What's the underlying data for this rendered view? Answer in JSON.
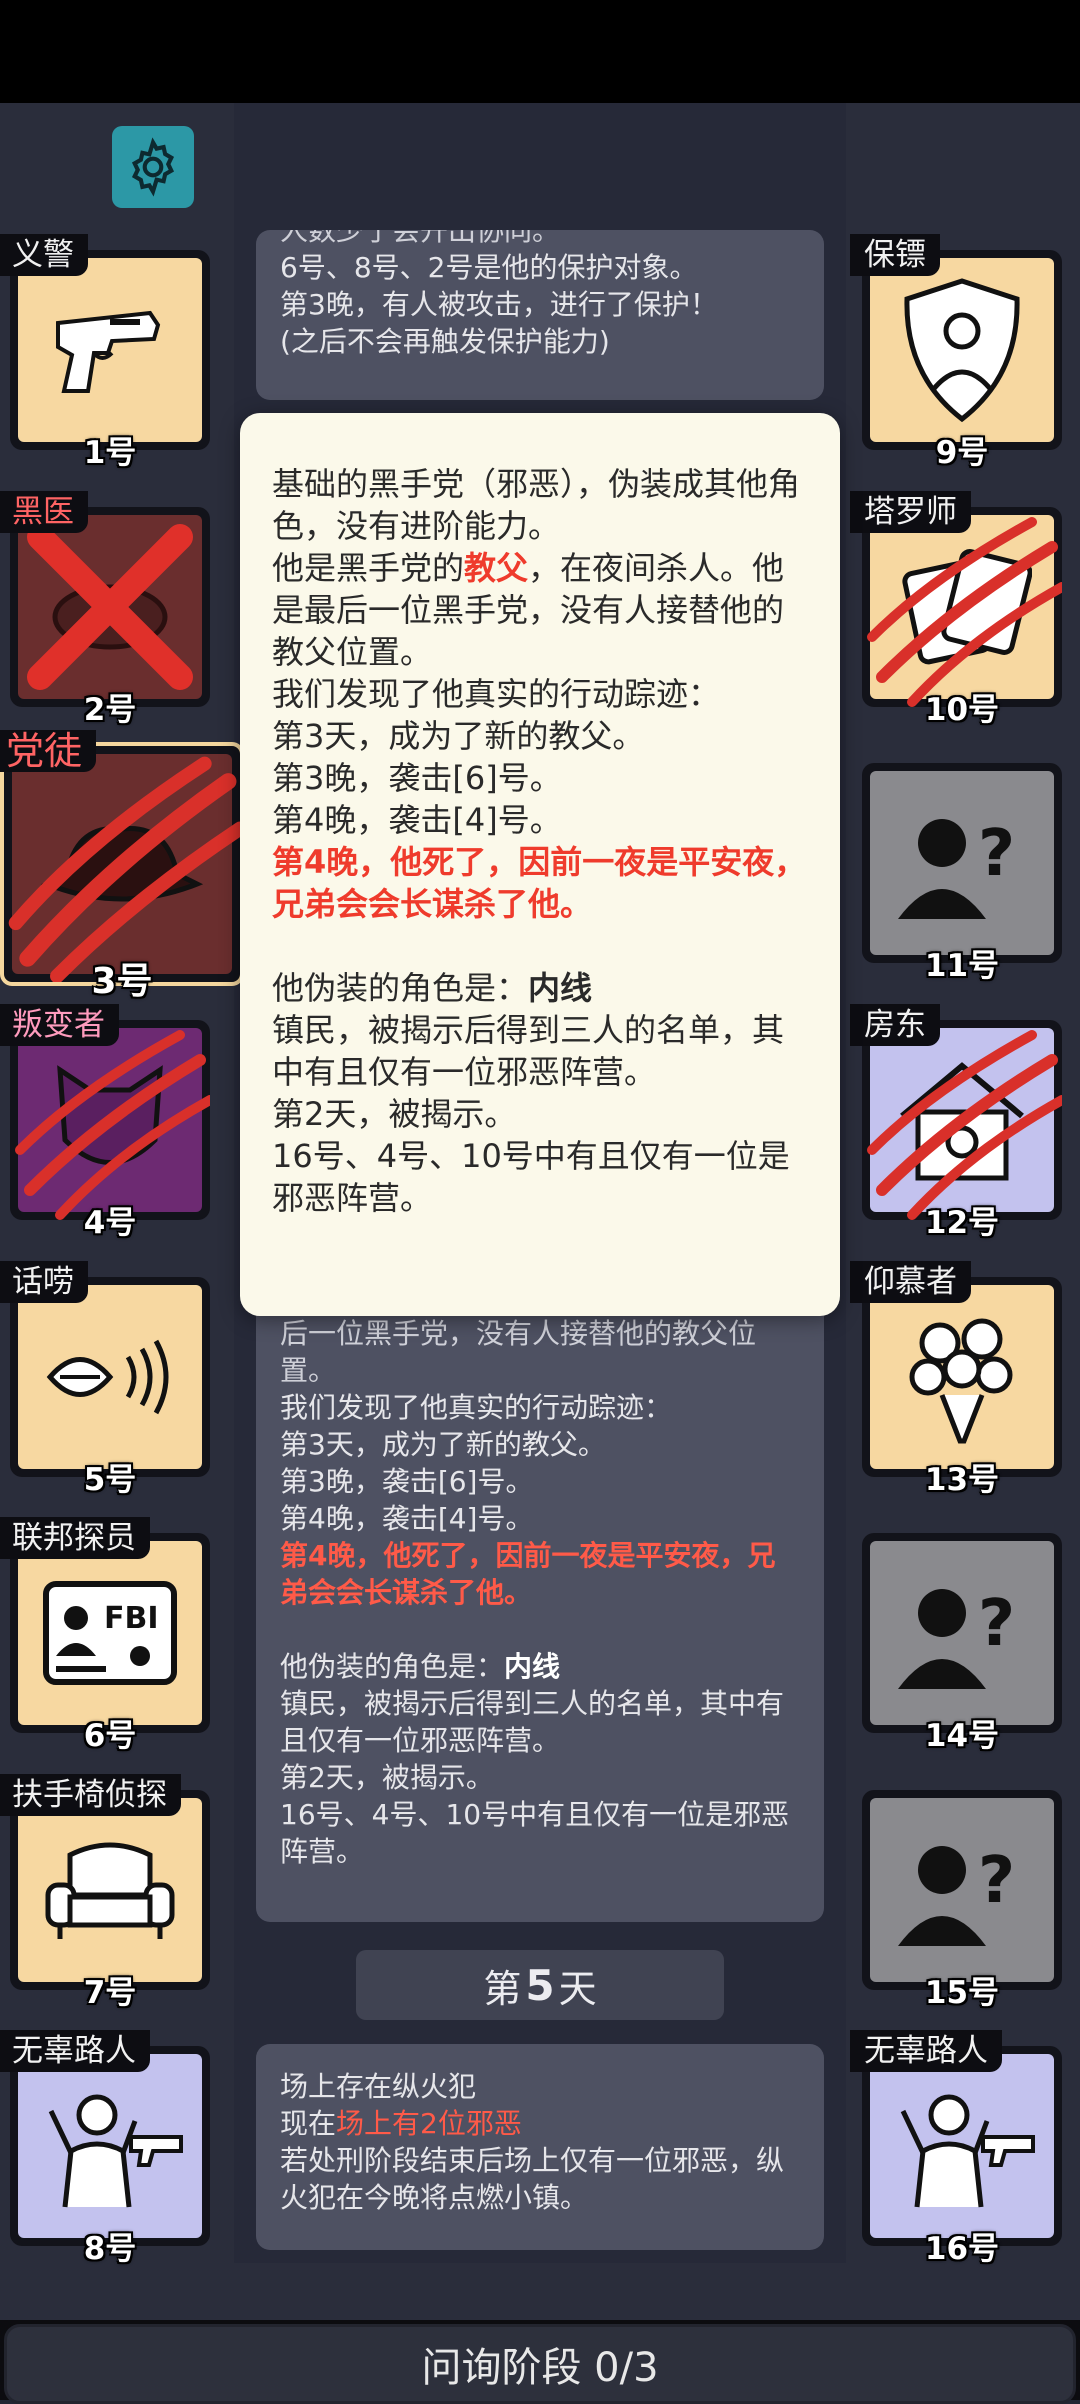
{
  "players": [
    {
      "role": "义警",
      "number": "1号",
      "icon": "pistol-icon"
    },
    {
      "role": "黑医",
      "number": "2号",
      "icon": "crossed-out-icon"
    },
    {
      "role": "党徒",
      "number": "3号",
      "icon": "fedora-hat-icon"
    },
    {
      "role": "叛变者",
      "number": "4号",
      "icon": "mask-icon"
    },
    {
      "role": "话唠",
      "number": "5号",
      "icon": "talking-mouth-icon"
    },
    {
      "role": "联邦探员",
      "number": "6号",
      "icon": "fbi-badge-icon"
    },
    {
      "role": "扶手椅侦探",
      "number": "7号",
      "icon": "armchair-icon"
    },
    {
      "role": "无辜路人",
      "number": "8号",
      "icon": "bystander-gun-icon"
    },
    {
      "role": "保镖",
      "number": "9号",
      "icon": "bodyguard-shield-icon"
    },
    {
      "role": "塔罗师",
      "number": "10号",
      "icon": "tarot-card-icon"
    },
    {
      "role": "",
      "number": "11号",
      "icon": "unknown-person-icon"
    },
    {
      "role": "房东",
      "number": "12号",
      "icon": "house-icon"
    },
    {
      "role": "仰慕者",
      "number": "13号",
      "icon": "bouquet-icon"
    },
    {
      "role": "",
      "number": "14号",
      "icon": "unknown-person-icon"
    },
    {
      "role": "",
      "number": "15号",
      "icon": "unknown-person-icon"
    },
    {
      "role": "无辜路人",
      "number": "16号",
      "icon": "bystander-gun-icon"
    }
  ],
  "log_top": {
    "line0": "人数少于会开出协同。",
    "line1": "6号、8号、2号是他的保护对象。",
    "line2": "第3晚，有人被攻击，进行了保护！",
    "line3": "(之后不会再触发保护能力)"
  },
  "popup": {
    "p1": "基础的黑手党（邪恶），伪装成其他角色，没有进阶能力。",
    "p2_pre": "他是黑手党的",
    "p2_role": "教父",
    "p2_post": "，在夜间杀人。他是最后一位黑手党，没有人接替他的教父位置。",
    "l1": "我们发现了他真实的行动踪迹：",
    "l2": "第3天，成为了新的教父。",
    "l3": "第3晚，袭击[6]号。",
    "l4": "第4晚，袭击[4]号。",
    "death": "第4晚，他死了，因前一夜是平安夜，兄弟会会长谋杀了他。",
    "disguise_label": "他伪装的角色是：",
    "disguise_role": "内线",
    "d1": "镇民，被揭示后得到三人的名单，其中有且仅有一位邪恶阵营。",
    "d2": "第2天，被揭示。",
    "d3": "16号、4号、10号中有且仅有一位是邪恶阵营。"
  },
  "log_mid": {
    "l0": "他是黑手党的教父，在夜间杀人。他是最后一位黑手党，没有人接替他的教父位置。",
    "l1": "我们发现了他真实的行动踪迹：",
    "l2": "第3天，成为了新的教父。",
    "l3": "第3晚，袭击[6]号。",
    "l4": "第4晚，袭击[4]号。",
    "death": "第4晚，他死了，因前一夜是平安夜，兄弟会会长谋杀了他。",
    "disguise_label": "他伪装的角色是：",
    "disguise_role": "内线",
    "d1": "镇民，被揭示后得到三人的名单，其中有且仅有一位邪恶阵营。",
    "d2": "第2天，被揭示。",
    "d3": "16号、4号、10号中有且仅有一位是邪恶阵营。"
  },
  "day": {
    "pre": "第",
    "num": "5",
    "post": "天"
  },
  "log_bottom": {
    "l1": "场上存在纵火犯",
    "l2_pre": "现在",
    "l2_red": "场上有2位邪恶",
    "l3": "若处刑阶段结束后场上仅有一位邪恶，纵火犯在今晚将点燃小镇。"
  },
  "footer": {
    "phase": "问询阶段 0/3"
  },
  "colors": {
    "accent_red": "#ef3b2c",
    "gear_teal": "#2c98a6",
    "popup_bg": "#fbf9ea"
  }
}
